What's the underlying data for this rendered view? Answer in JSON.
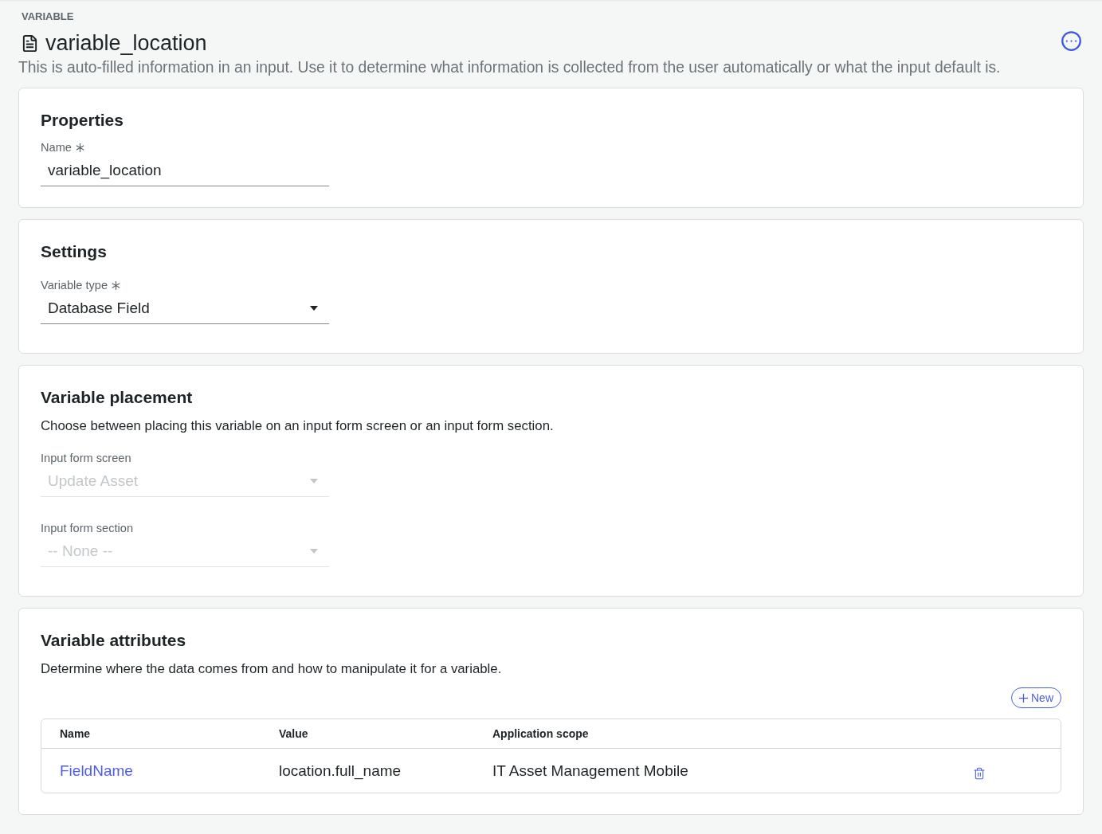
{
  "header": {
    "eyebrow": "VARIABLE",
    "title": "variable_location",
    "description": "This is auto-filled information in an input. Use it to determine what information is collected from the user automatically or what the input default is."
  },
  "sections": [
    {
      "title": "Properties",
      "fields": [
        {
          "kind": "text",
          "label": "Name",
          "required": true,
          "disabled": false,
          "value": "variable_location"
        }
      ]
    },
    {
      "title": "Settings",
      "fields": [
        {
          "kind": "select",
          "label": "Variable type",
          "required": true,
          "disabled": false,
          "value": "Database Field"
        }
      ]
    },
    {
      "title": "Variable placement",
      "description": "Choose between placing this variable on an input form screen or an input form section.",
      "fields": [
        {
          "kind": "select",
          "label": "Input form screen",
          "required": false,
          "disabled": true,
          "value": "Update Asset"
        },
        {
          "kind": "select",
          "label": "Input form section",
          "required": false,
          "disabled": true,
          "value": "-- None --"
        }
      ]
    },
    {
      "title": "Variable attributes",
      "description": "Determine where the data comes from and how to manipulate it for a variable.",
      "action": {
        "label": "New"
      },
      "table": {
        "columns": [
          "Name",
          "Value",
          "Application scope"
        ],
        "rows": [
          {
            "cells": [
              "FieldName",
              "location.full_name",
              "IT Asset Management Mobile"
            ]
          }
        ]
      }
    }
  ]
}
